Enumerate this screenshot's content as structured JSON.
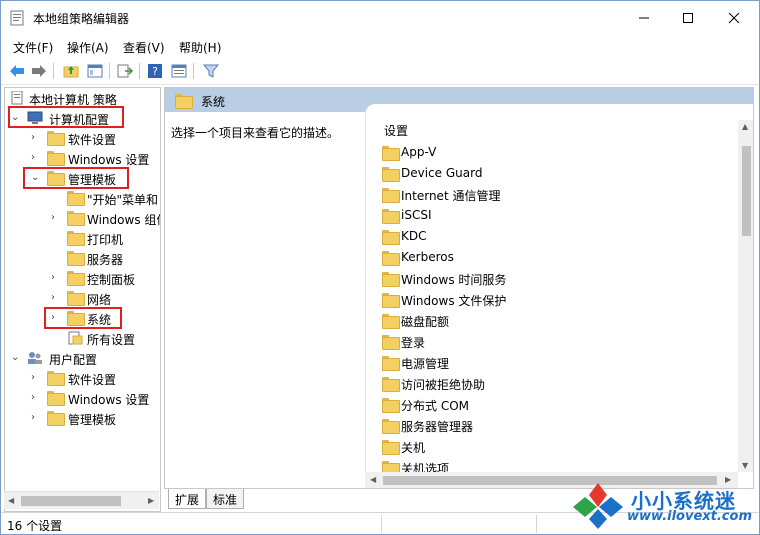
{
  "window": {
    "title": "本地组策略编辑器",
    "controls": {
      "minimize": "—",
      "maximize": "☐",
      "close": "✕"
    }
  },
  "menu": [
    "文件(F)",
    "操作(A)",
    "查看(V)",
    "帮助(H)"
  ],
  "toolbar": [
    "back-arrow-icon",
    "forward-arrow-icon",
    "up-folder-icon",
    "show-hide-tree-icon",
    "export-list-icon",
    "help-icon",
    "properties-icon",
    "filter-icon"
  ],
  "tree": {
    "root": "本地计算机 策略",
    "computer_config": "计算机配置",
    "software_settings": "软件设置",
    "windows_settings": "Windows 设置",
    "admin_templates": "管理模板",
    "start_menu": "\"开始\"菜单和",
    "windows_components": "Windows 组件",
    "printers": "打印机",
    "server": "服务器",
    "control_panel": "控制面板",
    "network": "网络",
    "system": "系统",
    "all_settings": "所有设置",
    "user_config": "用户配置",
    "user_software_settings": "软件设置",
    "user_windows_settings": "Windows 设置",
    "user_admin_templates": "管理模板"
  },
  "content": {
    "header": "系统",
    "description": "选择一个项目来查看它的描述。",
    "column_header": "设置",
    "items": [
      "App-V",
      "Device Guard",
      "Internet 通信管理",
      "iSCSI",
      "KDC",
      "Kerberos",
      "Windows 时间服务",
      "Windows 文件保护",
      "磁盘配额",
      "登录",
      "电源管理",
      "访问被拒绝协助",
      "分布式 COM",
      "服务器管理器",
      "关机",
      "关机选项"
    ]
  },
  "tabs": [
    "扩展",
    "标准"
  ],
  "status": {
    "text": "16 个设置"
  },
  "watermark": {
    "text": "小小系统迷",
    "url": "www.ilovext.com"
  },
  "colors": {
    "highlight_box": "#e02020",
    "header_band": "#b9cde5",
    "folder": "#f4cf63",
    "brand": "#1a6fc9"
  }
}
